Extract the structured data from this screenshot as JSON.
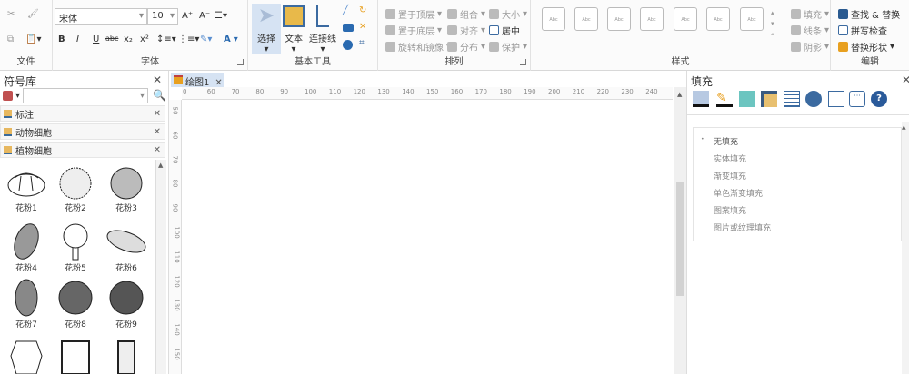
{
  "ribbon": {
    "file": {
      "label": "文件"
    },
    "font": {
      "label": "字体",
      "font_name": "宋体",
      "font_size": "10",
      "bold": "B",
      "italic": "I",
      "underline": "U",
      "strike": "abc",
      "sub": "x₂",
      "sup": "x²",
      "color": "A",
      "grow": "A⁺",
      "shrink": "A⁻"
    },
    "basic": {
      "label": "基本工具",
      "select": "选择",
      "text": "文本",
      "connector": "连接线"
    },
    "arrange": {
      "label": "排列",
      "items": [
        "置于顶层",
        "置于底层",
        "旋转和镜像",
        "组合",
        "对齐",
        "分布",
        "大小",
        "居中",
        "保护"
      ]
    },
    "styles": {
      "label": "样式",
      "swatch": "Abc",
      "fill": "填充",
      "line": "线条",
      "shadow": "阴影"
    },
    "edit": {
      "label": "编辑",
      "find": "查找 & 替换",
      "spell": "拼写检查",
      "replace": "替换形状"
    }
  },
  "library": {
    "title": "符号库",
    "search_placeholder": "",
    "categories": [
      "标注",
      "动物细胞",
      "植物细胞"
    ],
    "symbols": [
      "花粉1",
      "花粉2",
      "花粉3",
      "花粉4",
      "花粉5",
      "花粉6",
      "花粉7",
      "花粉8",
      "花粉9"
    ]
  },
  "canvas": {
    "tab": "绘图1",
    "hticks": [
      "0",
      "60",
      "70",
      "80",
      "90",
      "100",
      "110",
      "120",
      "130",
      "140",
      "150",
      "160",
      "170",
      "180",
      "190",
      "200",
      "210",
      "220",
      "230",
      "240"
    ],
    "vticks": [
      "50",
      "60",
      "70",
      "80",
      "90",
      "100",
      "110",
      "120",
      "130",
      "140",
      "150"
    ]
  },
  "fill_panel": {
    "title": "填充",
    "options": [
      "无填充",
      "实体填充",
      "渐变填充",
      "单色渐变填充",
      "图案填充",
      "图片或纹理填充"
    ]
  }
}
